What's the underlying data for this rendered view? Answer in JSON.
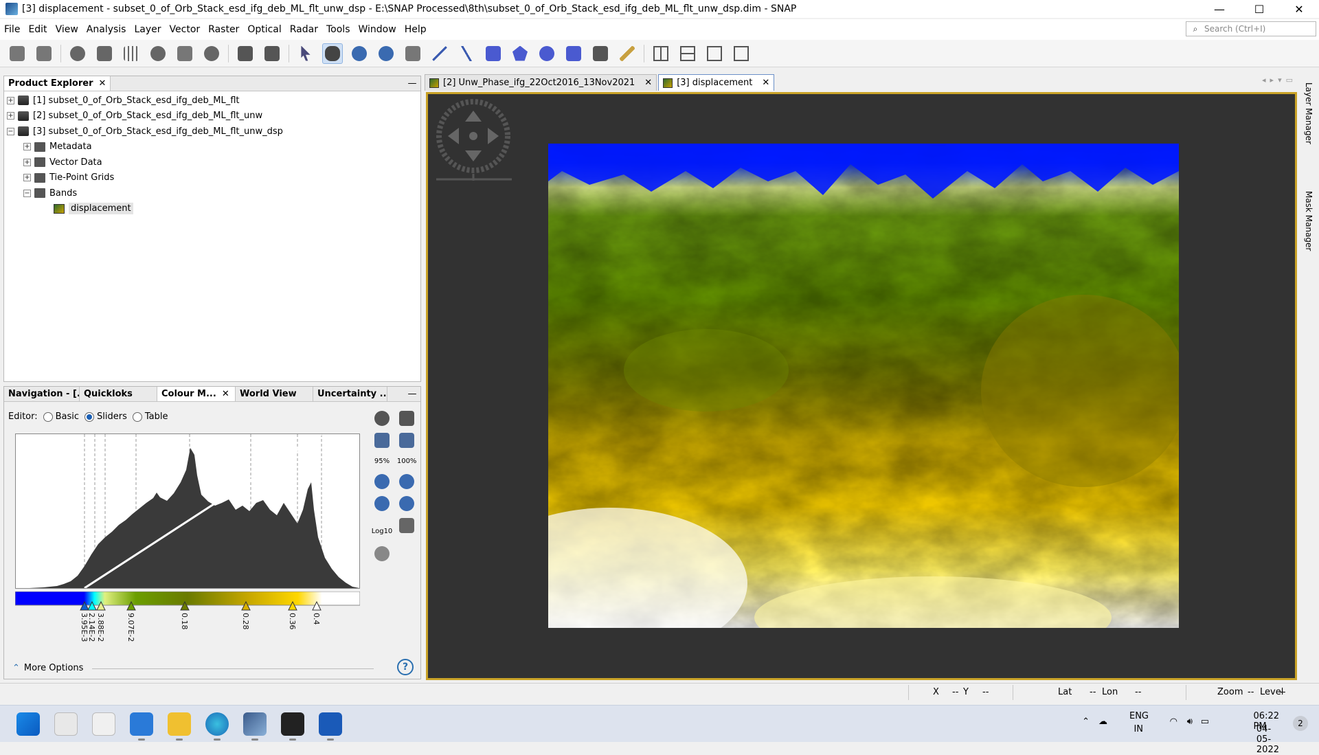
{
  "window": {
    "title": "[3] displacement - subset_0_of_Orb_Stack_esd_ifg_deb_ML_flt_unw_dsp - E:\\SNAP Processed\\8th\\subset_0_of_Orb_Stack_esd_ifg_deb_ML_flt_unw_dsp.dim - SNAP",
    "minimize": "—",
    "maximize": "☐",
    "close": "✕"
  },
  "menu": [
    "File",
    "Edit",
    "View",
    "Analysis",
    "Layer",
    "Vector",
    "Raster",
    "Optical",
    "Radar",
    "Tools",
    "Window",
    "Help"
  ],
  "search": {
    "placeholder": "Search (Ctrl+I)"
  },
  "product_explorer": {
    "tab": "Product Explorer",
    "close": "✕",
    "minimize": "—",
    "products": [
      "[1] subset_0_of_Orb_Stack_esd_ifg_deb_ML_flt",
      "[2] subset_0_of_Orb_Stack_esd_ifg_deb_ML_flt_unw",
      "[3] subset_0_of_Orb_Stack_esd_ifg_deb_ML_flt_unw_dsp"
    ],
    "nodes": [
      "Metadata",
      "Vector Data",
      "Tie-Point Grids",
      "Bands"
    ],
    "band": "displacement"
  },
  "tool_panel": {
    "tabs": [
      "Navigation - [...",
      "Quickloks",
      "Colour M...",
      "World View",
      "Uncertainty ..."
    ],
    "close": "✕",
    "minimize": "—",
    "editor_label": "Editor:",
    "editor_modes": [
      "Basic",
      "Sliders",
      "Table"
    ],
    "editor_selected": "Sliders",
    "zoom_95": "95%",
    "zoom_100": "100%",
    "log_label": "Log10",
    "more_options": "More Options",
    "slider_labels": [
      "3.95E-3",
      "2.14E-2",
      "3.88E-2",
      "9.07E-2",
      "0.18",
      "0.28",
      "0.36",
      "0.4"
    ],
    "colors": {
      "blue": "#0000ff",
      "cyan": "#00ffff",
      "green": "#6b9e00",
      "olive": "#8a8a00",
      "yellow": "#ffd700",
      "white": "#ffffff"
    }
  },
  "image_tabs": [
    {
      "label": "[2] Unw_Phase_ifg_22Oct2016_13Nov2021",
      "close": "✕"
    },
    {
      "label": "[3] displacement",
      "close": "✕"
    }
  ],
  "side_tools": [
    "Layer Manager",
    "Mask Manager"
  ],
  "status": {
    "x": "X",
    "x_val": "--",
    "y": "Y",
    "y_val": "--",
    "lat": "Lat",
    "lat_val": "--",
    "lon": "Lon",
    "lon_val": "--",
    "zoom": "Zoom",
    "zoom_val": "--",
    "level": "Level",
    "level_val": "--"
  },
  "taskbar": {
    "lang": "ENG",
    "region": "IN",
    "time": "06:22 PM",
    "date": "04-05-2022",
    "notifications": "2"
  }
}
